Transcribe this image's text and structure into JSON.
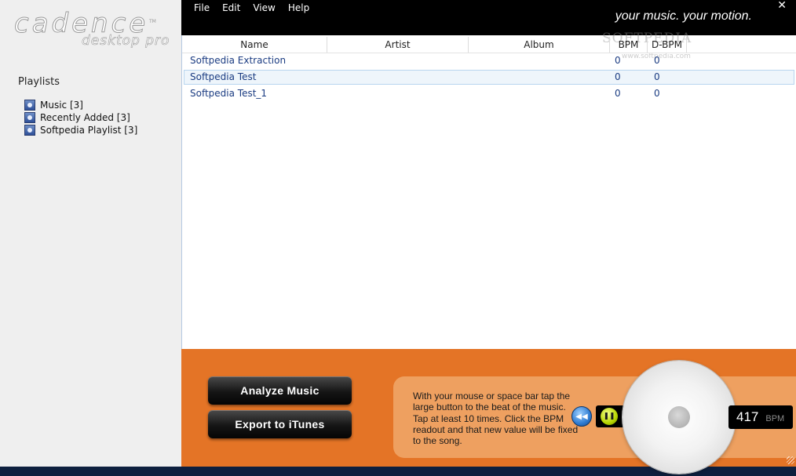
{
  "logo": {
    "main": "cadence",
    "tm": "TM",
    "sub": "desktop pro"
  },
  "sidebar": {
    "heading": "Playlists",
    "items": [
      {
        "label": "Music [3]"
      },
      {
        "label": "Recently Added [3]"
      },
      {
        "label": "Softpedia Playlist [3]"
      }
    ]
  },
  "menu": [
    "File",
    "Edit",
    "View",
    "Help"
  ],
  "slogan": "your music. your motion.",
  "close": "✕",
  "table": {
    "columns": [
      "Name",
      "Artist",
      "Album",
      "BPM",
      "D-BPM"
    ],
    "rows": [
      {
        "name": "Softpedia Extraction",
        "bpm": "0",
        "dbpm": "0"
      },
      {
        "name": "Softpedia Test",
        "bpm": "0",
        "dbpm": "0",
        "selected": true
      },
      {
        "name": "Softpedia Test_1",
        "bpm": "0",
        "dbpm": "0"
      }
    ]
  },
  "watermark": {
    "text": "SOFTPEDIA",
    "sub": "www.softpedia.com"
  },
  "buttons": {
    "analyze": "Analyze Music",
    "export": "Export to iTunes"
  },
  "instructions": "With your mouse or space bar tap the large button to the beat of the music. Tap at least 10 times. Click the BPM readout and that new value will be fixed to the song.",
  "bpm": {
    "value": "417",
    "unit": "BPM"
  },
  "icons": {
    "playlist": "playlist-icon",
    "rewind": "rewind-icon",
    "pause": "pause-icon"
  },
  "colors": {
    "accent": "#e47426",
    "tapPanel": "#eea060",
    "linkText": "#1b3c82"
  }
}
